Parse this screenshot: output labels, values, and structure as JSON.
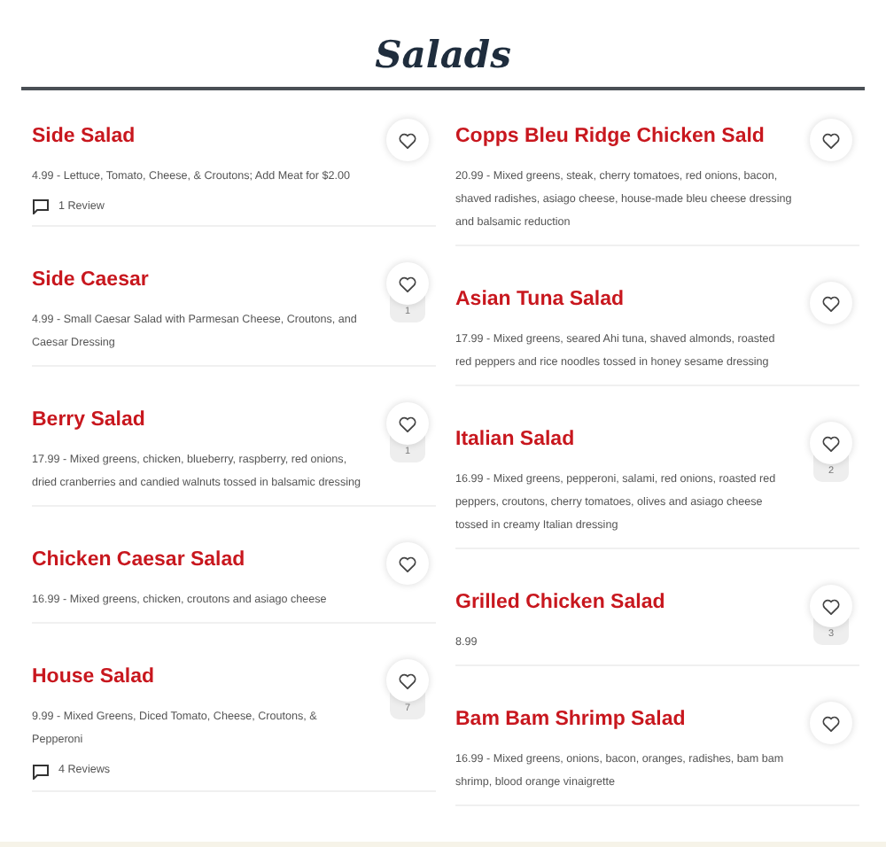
{
  "heading": "Salads",
  "columns": [
    [
      {
        "name": "Side Salad",
        "description": "4.99 - Lettuce, Tomato, Cheese, & Croutons; Add Meat for $2.00",
        "reviews": "1 Review"
      },
      {
        "name": "Side Caesar",
        "description": "4.99 - Small Caesar Salad with Parmesan Cheese, Croutons, and Caesar Dressing",
        "likes": "1"
      },
      {
        "name": "Berry Salad",
        "description": "17.99 - Mixed greens, chicken, blueberry, raspberry, red onions, dried cranberries and candied walnuts tossed in balsamic dressing",
        "likes": "1"
      },
      {
        "name": "Chicken Caesar Salad",
        "description": "16.99 - Mixed greens, chicken, croutons and asiago cheese"
      },
      {
        "name": "House Salad",
        "description": "9.99 - Mixed Greens, Diced Tomato, Cheese, Croutons, & Pepperoni",
        "likes": "7",
        "reviews": "4 Reviews"
      }
    ],
    [
      {
        "name": "Copps Bleu Ridge Chicken Sald",
        "description": "20.99 - Mixed greens, steak, cherry tomatoes, red onions, bacon, shaved radishes, asiago cheese, house-made bleu cheese dressing and balsamic reduction"
      },
      {
        "name": "Asian Tuna Salad",
        "description": "17.99 - Mixed greens, seared Ahi tuna, shaved almonds, roasted red peppers and rice noodles tossed in honey sesame dressing"
      },
      {
        "name": "Italian Salad",
        "description": "16.99 - Mixed greens, pepperoni, salami, red onions, roasted red peppers, croutons, cherry tomatoes, olives and asiago cheese tossed in creamy Italian dressing",
        "likes": "2"
      },
      {
        "name": "Grilled Chicken Salad",
        "description": "8.99",
        "likes": "3"
      },
      {
        "name": "Bam Bam Shrimp Salad",
        "description": "16.99 - Mixed greens, onions, bacon, oranges, radishes, bam bam shrimp, blood orange vinaigrette"
      }
    ]
  ]
}
